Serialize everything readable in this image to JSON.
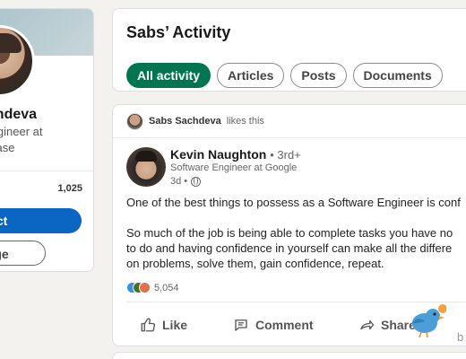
{
  "profile": {
    "name": "Sabs Sachdeva",
    "name_visible": "achdeva",
    "headline_line1": "Engineer at",
    "headline_line2": "nbase",
    "count": "1,025",
    "connect_label": "nnect",
    "message_label": "ssage"
  },
  "activity": {
    "title": "Sabs’ Activity",
    "filters": [
      {
        "label": "All activity",
        "active": true
      },
      {
        "label": "Articles",
        "active": false
      },
      {
        "label": "Posts",
        "active": false
      },
      {
        "label": "Documents",
        "active": false
      }
    ]
  },
  "post": {
    "liked_by": "Sabs Sachdeva",
    "liked_suffix": "likes this",
    "author": {
      "name": "Kevin Naughton",
      "degree": "• 3rd+",
      "headline": "Software Engineer at Google",
      "time": "3d •"
    },
    "text": {
      "line1": "One of the best things to possess as a Software Engineer is conf",
      "line2": "So much of the job is being able to complete tasks you have no",
      "line3": "to do and having confidence in yourself can make all the differe",
      "line4": "on problems, solve them, gain confidence, repeat."
    },
    "reaction_count": "5,054",
    "actions": {
      "like": "Like",
      "comment": "Comment",
      "share": "Share"
    }
  },
  "mascot": {
    "label": "b"
  },
  "colors": {
    "accent": "#0a66c2",
    "active_pill": "#01754f",
    "page_bg": "#f4f2ee"
  }
}
